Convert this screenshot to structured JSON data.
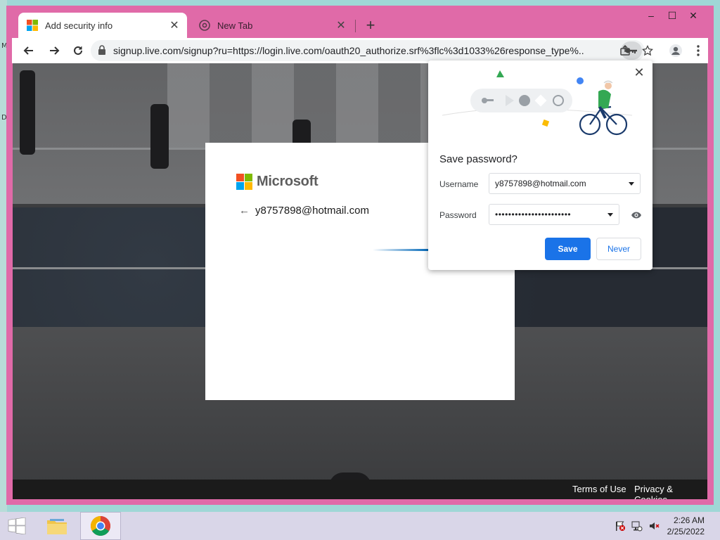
{
  "desktop": {
    "edge_letters": [
      "M",
      "D"
    ]
  },
  "window": {
    "tabs": [
      {
        "title": "Add security info",
        "active": true
      },
      {
        "title": "New Tab",
        "active": false
      }
    ],
    "new_tab": "+",
    "controls": {
      "minimize": "–",
      "maximize": "☐",
      "close": "✕"
    }
  },
  "toolbar": {
    "url": "signup.live.com/signup?ru=https://login.live.com/oauth20_authorize.srf%3flc%3d1033%26response_type%...",
    "icons": [
      "back-icon",
      "forward-icon",
      "reload-icon",
      "lock-icon",
      "key-icon",
      "share-icon",
      "star-icon",
      "profile-icon",
      "menu-icon"
    ]
  },
  "page": {
    "brand": "Microsoft",
    "identity": "y8757898@hotmail.com",
    "footer": {
      "terms": "Terms of Use",
      "privacy": "Privacy & Cookies"
    }
  },
  "save_password": {
    "title": "Save password?",
    "username_label": "Username",
    "username_value": "y8757898@hotmail.com",
    "password_label": "Password",
    "password_value": "•••••••••••••••••••••••",
    "save": "Save",
    "never": "Never",
    "close": "✕"
  },
  "taskbar": {
    "time": "2:26 AM",
    "date": "2/25/2022"
  },
  "colors": {
    "window_frame": "#e06aa8",
    "accent": "#1a73e8",
    "taskbar": "#d9d6e8"
  }
}
